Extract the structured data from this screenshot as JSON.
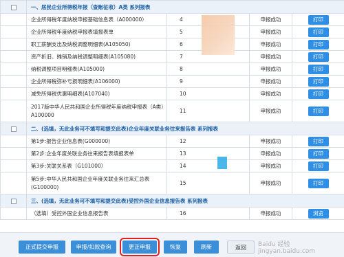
{
  "sections": [
    {
      "title": "一、居民企业所得税年报（查账征收）A类  系列报表",
      "rows": [
        {
          "name": "企业所得税年度纳税申报基础信息表（A000000）",
          "num": "4",
          "status": "申报成功",
          "action": "打印"
        },
        {
          "name": "企业所得税年度纳税申报表填报表单",
          "num": "5",
          "status": "申报成功",
          "action": "打印"
        },
        {
          "name": "职工薪酬支出及纳税调整明细表(A105050)",
          "num": "6",
          "status": "申报成功",
          "action": "打印"
        },
        {
          "name": "资产折旧、摊销及纳税调整明细表(A105080)",
          "num": "7",
          "status": "申报成功",
          "action": "打印"
        },
        {
          "name": "纳税调整项目明细表(A105000)",
          "num": "8",
          "status": "申报成功",
          "action": "打印"
        },
        {
          "name": "企业所得税弥补亏损明细表(A106000)",
          "num": "9",
          "status": "申报成功",
          "action": "打印"
        },
        {
          "name": "减免所得税优惠明细表(A107040)",
          "num": "10",
          "status": "申报成功",
          "action": "打印"
        },
        {
          "name": "2017版中华人民共和国企业所得税年度纳税申报表（A类）A100000",
          "num": "11",
          "status": "申报成功",
          "action": "打印"
        }
      ]
    },
    {
      "title": "二、(选填，无此业务可不填写和提交此表)企业年度关联业务往来报告表  系列报表",
      "rows": [
        {
          "name": "第1步:报告企业信息表(G000000)",
          "num": "12",
          "status": "申报成功",
          "action": "打印"
        },
        {
          "name": "第2步:企业年度关联业务往来报告表填报表单",
          "num": "13",
          "status": "申报成功",
          "action": "打印"
        },
        {
          "name": "第3步:关联关系表（G101000）",
          "num": "14",
          "status": "申报成功",
          "action": "打印"
        },
        {
          "name": "第5步:中华人民共和国企业年度关联业务往来汇总表(G100000)",
          "num": "15",
          "status": "申报成功",
          "action": "打印"
        }
      ]
    },
    {
      "title": "三、(选填，无此业务可不填写和提交此表)受控外国企业信息报告表  系列报表",
      "rows": [
        {
          "name": "（选填）受控外国企业信息报告表",
          "num": "16",
          "status": "申报成功",
          "action": "浏览"
        }
      ]
    }
  ],
  "toolbar": {
    "submit": "正式提交申报",
    "query": "申报/扣款查询",
    "correct": "更正申报",
    "restore": "恢复",
    "refresh": "刷新",
    "back": "返回"
  },
  "watermark": "Baidu 经验 jingyan.baidu.com",
  "colors": {
    "accent": "#2f8fe6",
    "section_text": "#1d5fa5",
    "highlight": "#e02020"
  }
}
